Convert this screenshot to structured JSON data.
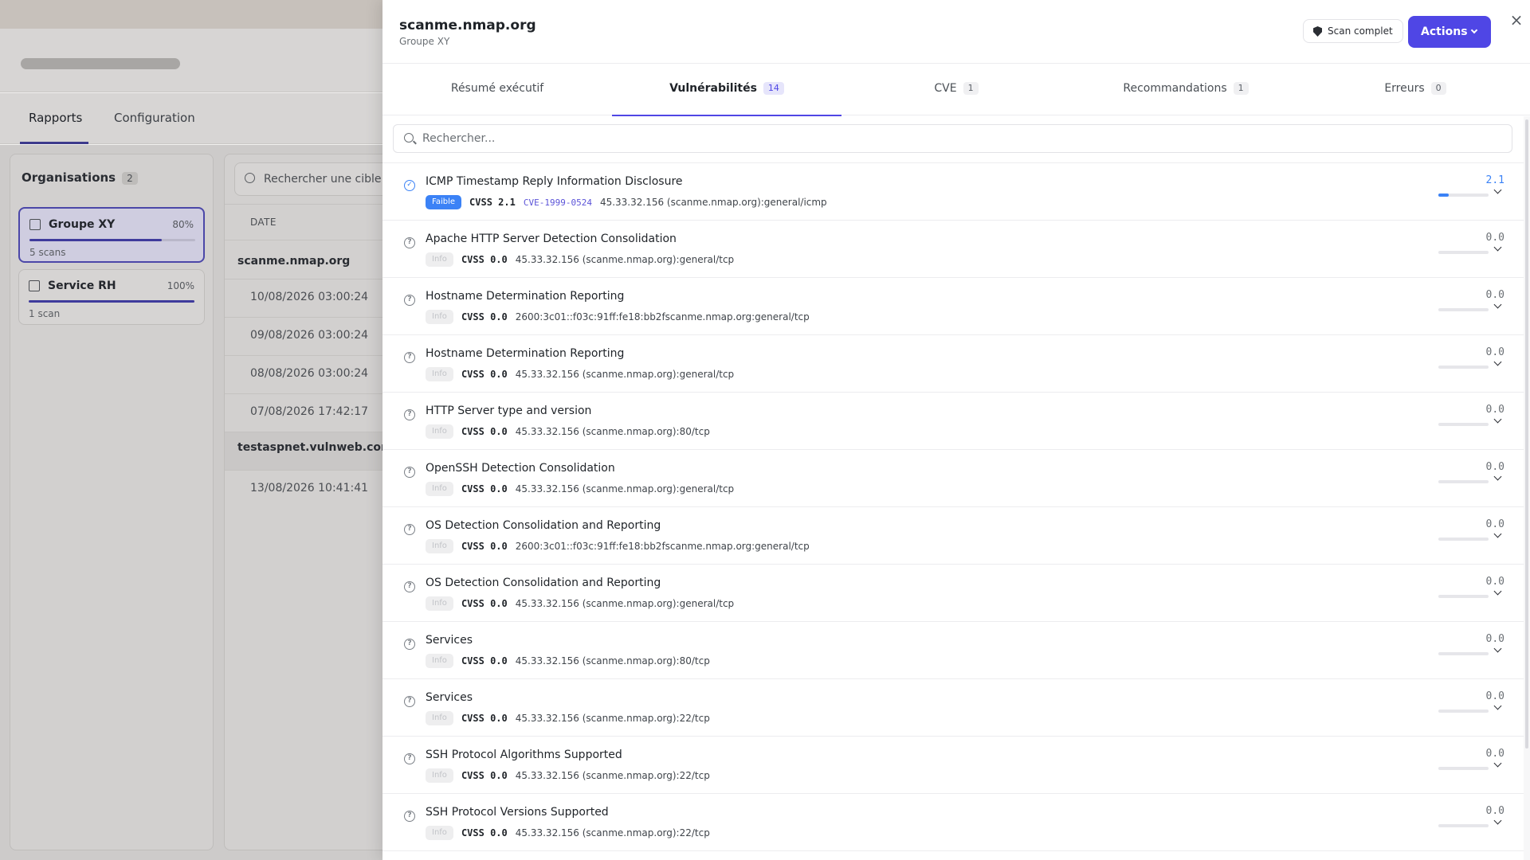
{
  "background": {
    "tabs": [
      {
        "label": "Rapports",
        "active": true
      },
      {
        "label": "Configuration",
        "active": false
      }
    ],
    "organisations": {
      "title": "Organisations",
      "count": "2",
      "items": [
        {
          "name": "Groupe XY",
          "percent": "80%",
          "progress": 0.8,
          "scans": "5 scans",
          "selected": true
        },
        {
          "name": "Service RH",
          "percent": "100%",
          "progress": 1.0,
          "scans": "1 scan",
          "selected": false
        }
      ]
    },
    "scans": {
      "search_placeholder": "Rechercher une cible o",
      "date_header": "DATE",
      "hosts": [
        {
          "host": "scanme.nmap.org",
          "dates": [
            "10/08/2026 03:00:24",
            "09/08/2026 03:00:24",
            "08/08/2026 03:00:24",
            "07/08/2026 17:42:17"
          ]
        },
        {
          "host": "testaspnet.vulnweb.com",
          "dates": [
            "13/08/2026 10:41:41"
          ]
        }
      ]
    }
  },
  "drawer": {
    "title": "scanme.nmap.org",
    "subtitle": "Groupe XY",
    "scan_button": "Scan complet",
    "actions_button": "Actions",
    "close_label": "×",
    "tabs": [
      {
        "label": "Résumé exécutif",
        "badge": ""
      },
      {
        "label": "Vulnérabilités",
        "badge": "14",
        "active": true
      },
      {
        "label": "CVE",
        "badge": "1"
      },
      {
        "label": "Recommandations",
        "badge": "1"
      },
      {
        "label": "Erreurs",
        "badge": "0"
      }
    ],
    "search_placeholder": "Rechercher...",
    "cvss_label": "CVSS",
    "vulnerabilities": [
      {
        "name": "ICMP Timestamp Reply Information Disclosure",
        "severity": "Faible",
        "severity_level": "low",
        "cvss": "2.1",
        "cve": "CVE-1999-0524",
        "target": "45.33.32.156 (scanme.nmap.org):general/icmp",
        "status": "checked"
      },
      {
        "name": "Apache HTTP Server Detection Consolidation",
        "severity": "Info",
        "severity_level": "info",
        "cvss": "0.0",
        "cve": "",
        "target": "45.33.32.156 (scanme.nmap.org):general/tcp",
        "status": "unknown"
      },
      {
        "name": "Hostname Determination Reporting",
        "severity": "Info",
        "severity_level": "info",
        "cvss": "0.0",
        "cve": "",
        "target": "2600:3c01::f03c:91ff:fe18:bb2fscanme.nmap.org:general/tcp",
        "status": "unknown"
      },
      {
        "name": "Hostname Determination Reporting",
        "severity": "Info",
        "severity_level": "info",
        "cvss": "0.0",
        "cve": "",
        "target": "45.33.32.156 (scanme.nmap.org):general/tcp",
        "status": "unknown"
      },
      {
        "name": "HTTP Server type and version",
        "severity": "Info",
        "severity_level": "info",
        "cvss": "0.0",
        "cve": "",
        "target": "45.33.32.156 (scanme.nmap.org):80/tcp",
        "status": "unknown"
      },
      {
        "name": "OpenSSH Detection Consolidation",
        "severity": "Info",
        "severity_level": "info",
        "cvss": "0.0",
        "cve": "",
        "target": "45.33.32.156 (scanme.nmap.org):general/tcp",
        "status": "unknown"
      },
      {
        "name": "OS Detection Consolidation and Reporting",
        "severity": "Info",
        "severity_level": "info",
        "cvss": "0.0",
        "cve": "",
        "target": "2600:3c01::f03c:91ff:fe18:bb2fscanme.nmap.org:general/tcp",
        "status": "unknown"
      },
      {
        "name": "OS Detection Consolidation and Reporting",
        "severity": "Info",
        "severity_level": "info",
        "cvss": "0.0",
        "cve": "",
        "target": "45.33.32.156 (scanme.nmap.org):general/tcp",
        "status": "unknown"
      },
      {
        "name": "Services",
        "severity": "Info",
        "severity_level": "info",
        "cvss": "0.0",
        "cve": "",
        "target": "45.33.32.156 (scanme.nmap.org):80/tcp",
        "status": "unknown"
      },
      {
        "name": "Services",
        "severity": "Info",
        "severity_level": "info",
        "cvss": "0.0",
        "cve": "",
        "target": "45.33.32.156 (scanme.nmap.org):22/tcp",
        "status": "unknown"
      },
      {
        "name": "SSH Protocol Algorithms Supported",
        "severity": "Info",
        "severity_level": "info",
        "cvss": "0.0",
        "cve": "",
        "target": "45.33.32.156 (scanme.nmap.org):22/tcp",
        "status": "unknown"
      },
      {
        "name": "SSH Protocol Versions Supported",
        "severity": "Info",
        "severity_level": "info",
        "cvss": "0.0",
        "cve": "",
        "target": "45.33.32.156 (scanme.nmap.org):22/tcp",
        "status": "unknown"
      }
    ]
  },
  "colors": {
    "accent": "#4f46e5",
    "low_severity": "#3b82f6"
  }
}
